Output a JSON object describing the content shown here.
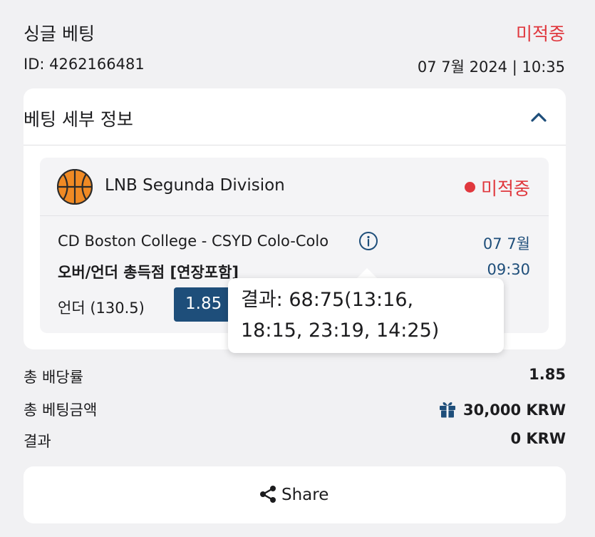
{
  "bet": {
    "title": "싱글 베팅",
    "status": "미적중",
    "id_label": "ID: 4262166481",
    "date_label": "07 7월 2024 | 10:35"
  },
  "details": {
    "title": "베팅 세부 정보",
    "toggle_icon": "chevron-up-icon"
  },
  "event": {
    "sport_icon": "basketball-icon",
    "league": "LNB Segunda Division",
    "status": "미적중",
    "teams": "CD Boston College - CSYD Colo-Colo",
    "market": "오버/언더 총득점 [연장포함]",
    "selection": "언더 (130.5)",
    "odds": "1.85",
    "date": "07 7월",
    "time": "09:30"
  },
  "tooltip": {
    "line1": "결과: 68:75(13:16,",
    "line2": "18:15, 23:19, 14:25)"
  },
  "summary": {
    "total_odds_label": "총 배당률",
    "total_odds_value": "1.85",
    "total_stake_label": "총 베팅금액",
    "total_stake_value": "30,000 KRW",
    "result_label": "결과",
    "result_value": "0 KRW"
  },
  "share": {
    "label": "Share",
    "icon": "share-icon"
  },
  "colors": {
    "lost": "#e0383e",
    "accent": "#1e4e7a",
    "ball": "#f08a24"
  }
}
